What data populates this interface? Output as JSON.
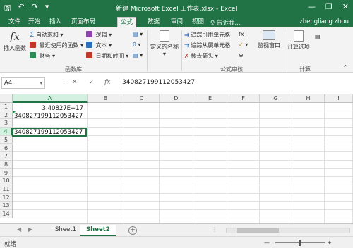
{
  "window": {
    "title": "新建 Microsoft Excel 工作表.xlsx - Excel",
    "save_glyph": "🖫",
    "undo_glyph": "↶",
    "redo_glyph": "↷",
    "customize_glyph": "▾",
    "minimize_glyph": "—",
    "restore_glyph": "❐",
    "close_glyph": "✕"
  },
  "tabs": [
    "文件",
    "开始",
    "插入",
    "页面布局",
    "公式",
    "数据",
    "审阅",
    "视图"
  ],
  "active_tab": "公式",
  "tell_me": "♀ 告诉我...",
  "user": "zhengliang zhou",
  "ribbon": {
    "insert_function": "插入函数",
    "fx_glyph": "fx",
    "autosum": "自动求和",
    "recent": "最近使用的函数",
    "financial": "财务",
    "logical": "逻辑",
    "text": "文本",
    "datetime": "日期和时间",
    "lookup_glyph": "▤",
    "math_glyph": "θ",
    "more_glyph": "▤",
    "group_function_library": "函数库",
    "defined_names": "定义的名称",
    "trace_precedents": "追踪引用单元格",
    "trace_dependents": "追踪从属单元格",
    "remove_arrows": "移去箭头",
    "show_formulas_glyph": "fx",
    "error_check_glyph": "✓",
    "evaluate_glyph": "⊕",
    "group_formula_auditing": "公式审核",
    "watch_window": "监视窗口",
    "calc_options": "计算选项",
    "calc_now_glyph": "▤",
    "group_calculation": "计算",
    "colors": {
      "sum": "#3a7cc4",
      "recent": "#c0392b",
      "financial": "#2e8b57",
      "logical": "#8e44ad",
      "text": "#2c6fbb",
      "datetime": "#c0392b"
    }
  },
  "formula_bar": {
    "name_box": "A4",
    "cancel_glyph": "✕",
    "enter_glyph": "✓",
    "fx_glyph": "fx",
    "formula": "340827199112053427"
  },
  "grid": {
    "columns": [
      "A",
      "B",
      "C",
      "D",
      "E",
      "F",
      "G",
      "H",
      "I"
    ],
    "rows": [
      "1",
      "2",
      "3",
      "4",
      "5",
      "6",
      "7",
      "8",
      "9",
      "10",
      "11",
      "12",
      "13",
      "14"
    ],
    "cells": {
      "A1": "3.40827E+17",
      "A2": "340827199112053427",
      "A4": "340827199112053427"
    },
    "selected": "A4"
  },
  "sheets": {
    "prev_glyph": "◀",
    "next_glyph": "▶",
    "tabs": [
      "Sheet1",
      "Sheet2"
    ],
    "active": "Sheet2",
    "add_glyph": "+"
  },
  "status": {
    "ready": "就绪",
    "zoom_out": "—",
    "zoom_in": "+"
  },
  "accent": "#217346"
}
